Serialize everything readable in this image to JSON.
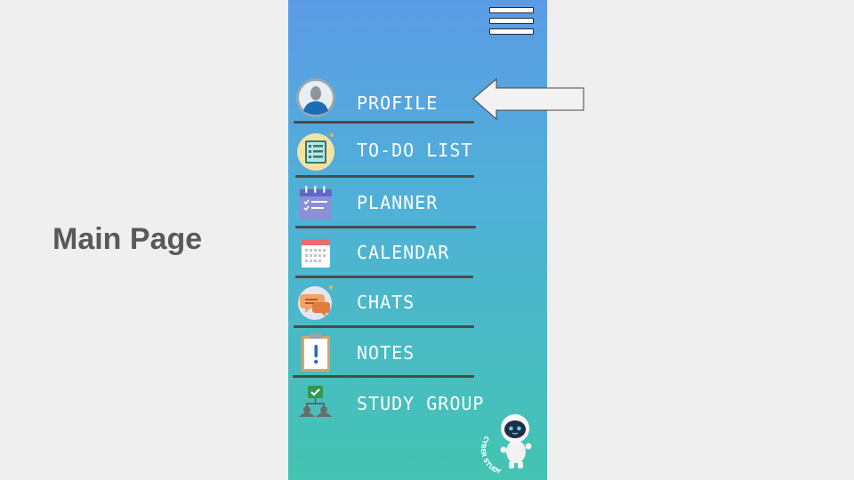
{
  "page": {
    "title": "Main Page"
  },
  "menu": {
    "items": [
      {
        "label": "PROFILE",
        "icon": "profile-icon"
      },
      {
        "label": "TO-DO LIST",
        "icon": "todo-list-icon"
      },
      {
        "label": "PLANNER",
        "icon": "planner-icon"
      },
      {
        "label": "CALENDAR",
        "icon": "calendar-icon"
      },
      {
        "label": "CHATS",
        "icon": "chats-icon"
      },
      {
        "label": "NOTES",
        "icon": "notes-icon"
      },
      {
        "label": "STUDY GROUP",
        "icon": "study-group-icon"
      }
    ]
  },
  "logo": {
    "text": "CYBER STUDY"
  },
  "colors": {
    "gradient_top": "#5b9be6",
    "gradient_bottom": "#44c4b2",
    "label": "#ffffff",
    "divider": "#4a4a4a",
    "title": "#595959"
  }
}
